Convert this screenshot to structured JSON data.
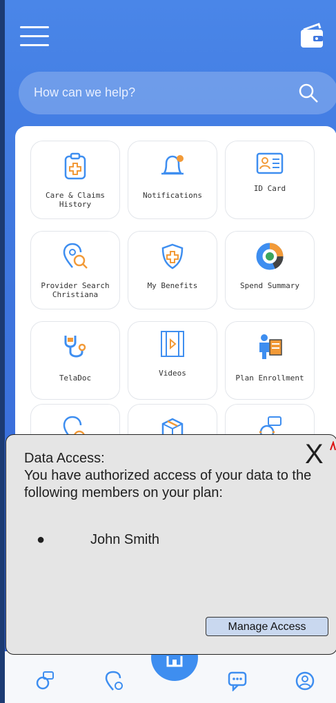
{
  "search": {
    "placeholder": "How can we help?"
  },
  "tiles": [
    {
      "label": "Care & Claims History",
      "icon": "clipboard-medical-icon"
    },
    {
      "label": "Notifications",
      "icon": "bell-icon"
    },
    {
      "label": "ID Card",
      "icon": "id-card-icon"
    },
    {
      "label": "Provider Search Christiana",
      "icon": "location-search-icon"
    },
    {
      "label": "My Benefits",
      "icon": "shield-medical-icon"
    },
    {
      "label": "Spend Summary",
      "icon": "donut-chart-icon"
    },
    {
      "label": "TelaDoc",
      "icon": "stethoscope-icon"
    },
    {
      "label": "Videos",
      "icon": "video-film-icon"
    },
    {
      "label": "Plan Enrollment",
      "icon": "enrollment-icon"
    }
  ],
  "dialog": {
    "title": "Data Access:",
    "body": "You have authorized access of your data to the following members on your plan:",
    "bullet": "●",
    "member": "John Smith",
    "close": "X",
    "button": "Manage Access"
  },
  "colors": {
    "accent": "#3e8ef0",
    "icon_orange": "#f29a38",
    "background": "#3f78e0"
  }
}
